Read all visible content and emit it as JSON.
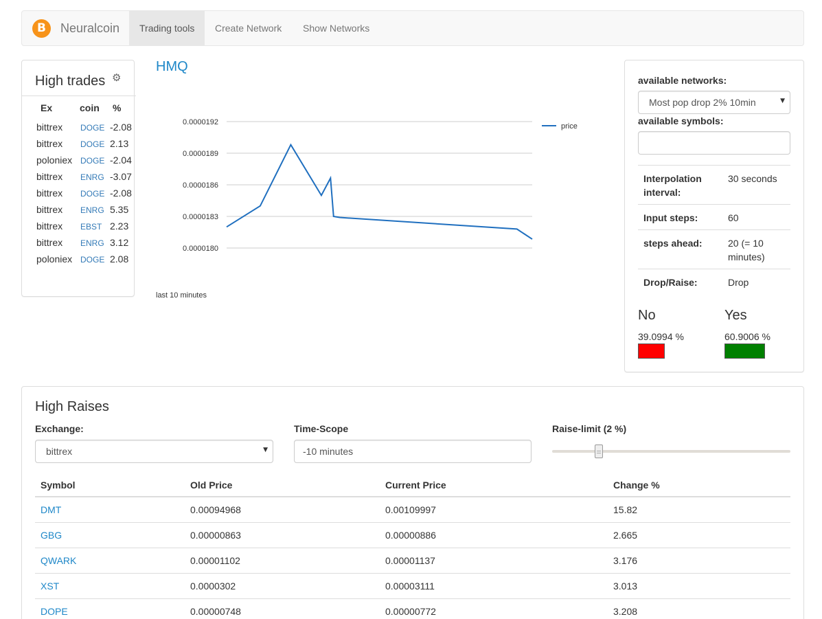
{
  "navbar": {
    "brand_logo": "bitcoin-logo",
    "brand": "Neuralcoin",
    "items": [
      "Trading tools",
      "Create Network",
      "Show Networks"
    ],
    "active_index": 0
  },
  "high_trades": {
    "title": "High trades",
    "headers": [
      "Ex",
      "coin",
      "%"
    ],
    "rows": [
      {
        "ex": "bittrex",
        "coin": "DOGE",
        "pct": "-2.08"
      },
      {
        "ex": "bittrex",
        "coin": "DOGE",
        "pct": "2.13"
      },
      {
        "ex": "poloniex",
        "coin": "DOGE",
        "pct": "-2.04"
      },
      {
        "ex": "bittrex",
        "coin": "ENRG",
        "pct": "-3.07"
      },
      {
        "ex": "bittrex",
        "coin": "DOGE",
        "pct": "-2.08"
      },
      {
        "ex": "bittrex",
        "coin": "ENRG",
        "pct": "5.35"
      },
      {
        "ex": "bittrex",
        "coin": "EBST",
        "pct": "2.23"
      },
      {
        "ex": "bittrex",
        "coin": "ENRG",
        "pct": "3.12"
      },
      {
        "ex": "poloniex",
        "coin": "DOGE",
        "pct": "2.08"
      }
    ]
  },
  "chart": {
    "title": "HMQ",
    "subtitle": "last 10 minutes"
  },
  "chart_data": {
    "type": "line",
    "title": "HMQ",
    "xlabel": "last 10 minutes",
    "ylabel": "",
    "x": [
      0.0,
      0.11,
      0.21,
      0.31,
      0.34,
      0.35,
      0.37,
      0.95,
      1.0
    ],
    "series": [
      {
        "name": "price",
        "color": "#1f6fbf",
        "values": [
          1.82e-05,
          1.84e-05,
          1.898e-05,
          1.85e-05,
          1.86636e-05,
          1.83e-05,
          1.829e-05,
          1.818e-05,
          1.80844e-05
        ]
      }
    ],
    "yticks": [
      "0.0000180",
      "0.0000183",
      "0.0000186",
      "0.0000189",
      "0.0000192"
    ],
    "ytick_values": [
      1.8e-05,
      1.83e-05,
      1.86e-05,
      1.89e-05,
      1.92e-05
    ],
    "ylim": [
      1.8e-05,
      1.92e-05
    ],
    "xlim": [
      0,
      1
    ],
    "grid": true,
    "legend": "top-right"
  },
  "network_panel": {
    "available_networks_label": "available networks:",
    "selected_network": "Most pop drop 2% 10min",
    "available_symbols_label": "available symbols:",
    "symbols_value": "",
    "params": [
      {
        "key": "Interpolation interval:",
        "value": "30 seconds"
      },
      {
        "key": "Input steps:",
        "value": "60"
      },
      {
        "key": "steps ahead:",
        "value": "20 (= 10 minutes)"
      },
      {
        "key": "Drop/Raise:",
        "value": "Drop"
      }
    ],
    "no_label": "No",
    "no_pct": "39.0994 %",
    "no_color": "#ff0000",
    "yes_label": "Yes",
    "yes_pct": "60.9006 %",
    "yes_color": "#008000"
  },
  "high_raises": {
    "title": "High Raises",
    "exchange_label": "Exchange:",
    "exchange_value": "bittrex",
    "timescope_label": "Time-Scope",
    "timescope_value": "-10 minutes",
    "raise_limit_label": "Raise-limit (2 %)",
    "raise_limit_fraction": 0.18,
    "headers": [
      "Symbol",
      "Old Price",
      "Current Price",
      "Change %"
    ],
    "rows": [
      {
        "symbol": "DMT",
        "old": "0.00094968",
        "current": "0.00109997",
        "change": "15.82"
      },
      {
        "symbol": "GBG",
        "old": "0.00000863",
        "current": "0.00000886",
        "change": "2.665"
      },
      {
        "symbol": "QWARK",
        "old": "0.00001102",
        "current": "0.00001137",
        "change": "3.176"
      },
      {
        "symbol": "XST",
        "old": "0.0000302",
        "current": "0.00003111",
        "change": "3.013"
      },
      {
        "symbol": "DOPE",
        "old": "0.00000748",
        "current": "0.00000772",
        "change": "3.208"
      }
    ]
  }
}
